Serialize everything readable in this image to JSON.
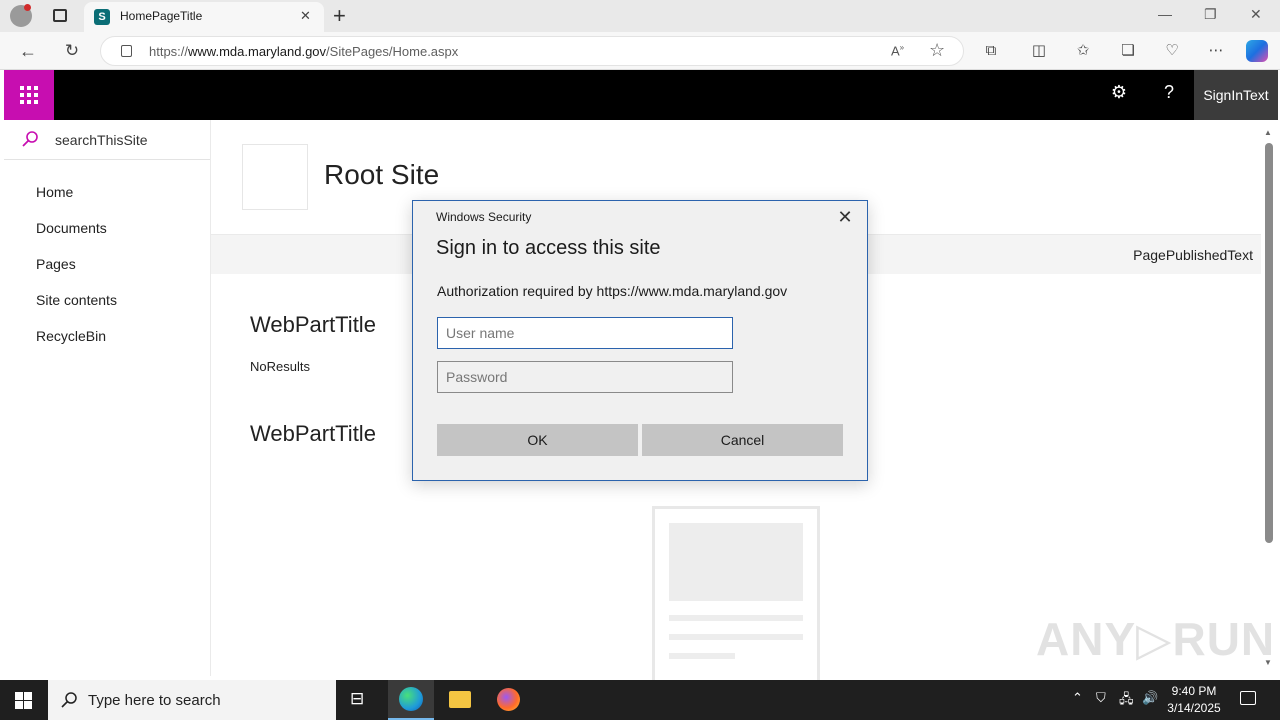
{
  "browser": {
    "tab_title": "HomePageTitle",
    "new_tab_symbol": "+",
    "url_prefix": "https://",
    "url_domain": "www.mda.maryland.gov",
    "url_path": "/SitePages/Home.aspx",
    "window_controls": [
      "—",
      "❐",
      "✕"
    ]
  },
  "suitebar": {
    "sign_in": "SignInText",
    "help_glyph": "?"
  },
  "leftnav": {
    "search_placeholder": "searchThisSite",
    "items": [
      {
        "label": "Home"
      },
      {
        "label": "Documents"
      },
      {
        "label": "Pages"
      },
      {
        "label": "Site contents"
      },
      {
        "label": "RecycleBin"
      }
    ]
  },
  "main": {
    "site_title": "Root Site",
    "page_published": "PagePublishedText",
    "webparts": [
      {
        "title": "WebPartTitle",
        "body": "NoResults"
      },
      {
        "title": "WebPartTitle"
      }
    ]
  },
  "dialog": {
    "caption": "Windows Security",
    "heading": "Sign in to access this site",
    "message": "Authorization required by https://www.mda.maryland.gov",
    "username_placeholder": "User name",
    "password_placeholder": "Password",
    "ok_label": "OK",
    "cancel_label": "Cancel",
    "close_glyph": "✕"
  },
  "watermark": "ANY▷RUN",
  "taskbar": {
    "search_placeholder": "Type here to search",
    "time": "9:40 PM",
    "date": "3/14/2025"
  },
  "colors": {
    "suite_accent": "#c70eb0",
    "dialog_border": "#2b63ad",
    "suitebar_bg": "#000000"
  }
}
